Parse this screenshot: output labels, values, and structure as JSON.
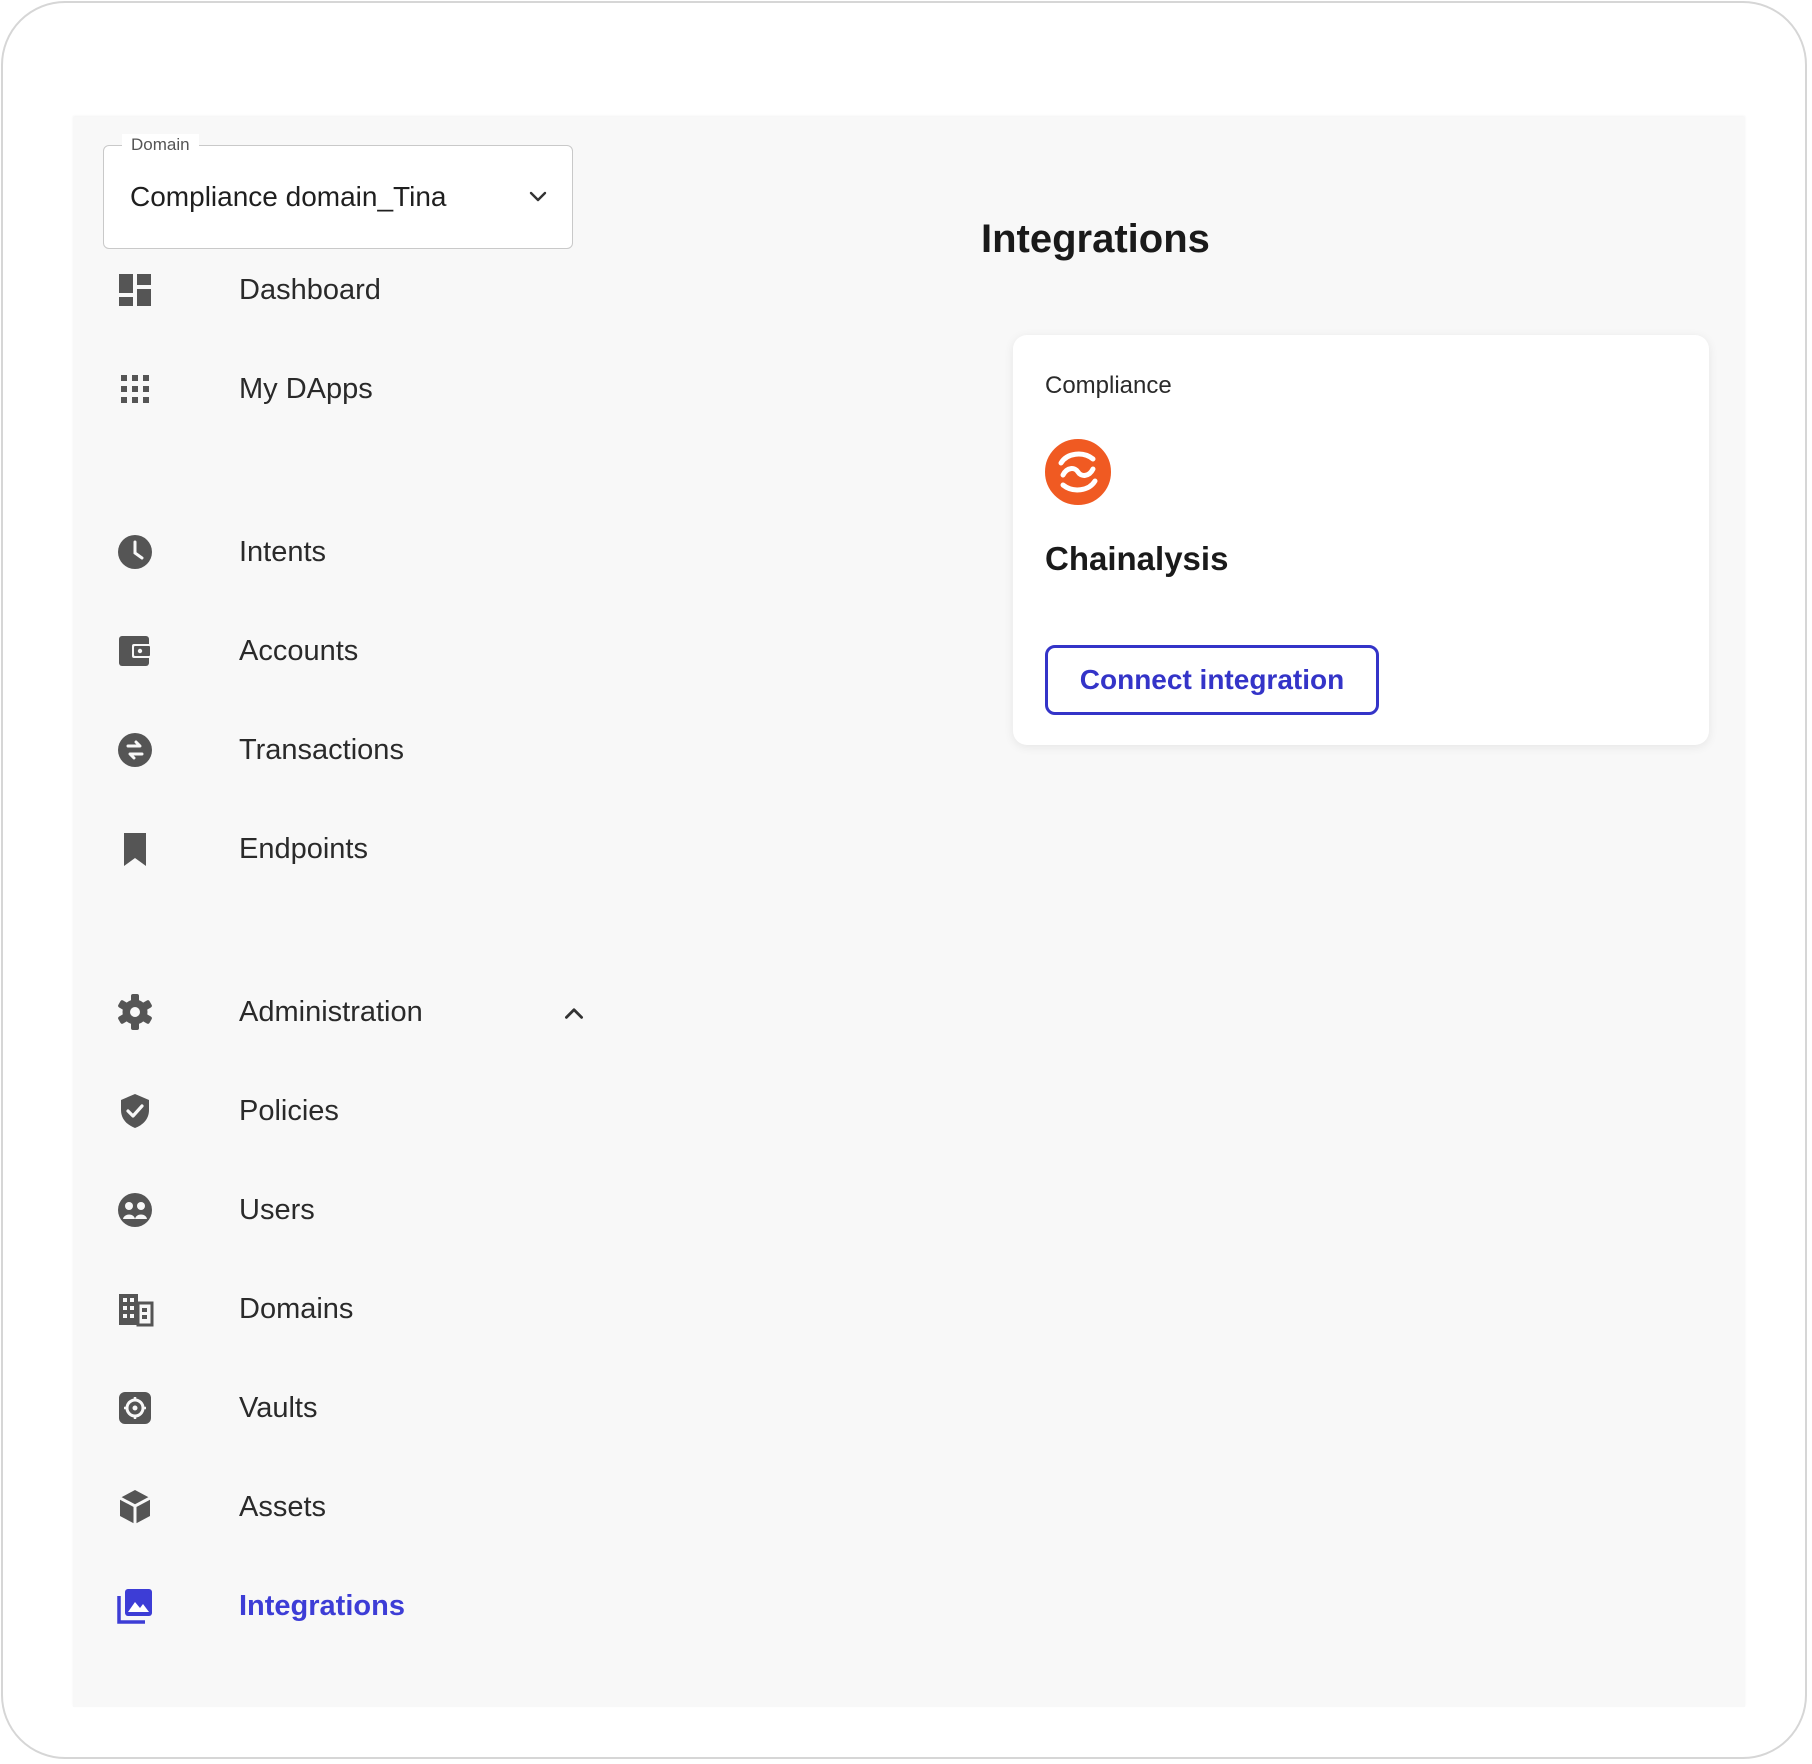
{
  "domain_select": {
    "legend": "Domain",
    "value": "Compliance domain_Tina"
  },
  "sidebar": {
    "items": [
      {
        "label": "Dashboard",
        "icon": "dashboard-icon"
      },
      {
        "label": "My DApps",
        "icon": "apps-grid-icon"
      },
      {
        "label": "Intents",
        "icon": "clock-icon"
      },
      {
        "label": "Accounts",
        "icon": "wallet-icon"
      },
      {
        "label": "Transactions",
        "icon": "swap-icon"
      },
      {
        "label": "Endpoints",
        "icon": "bookmark-icon"
      },
      {
        "label": "Administration",
        "icon": "gear-icon",
        "expanded": true
      },
      {
        "label": "Policies",
        "icon": "shield-check-icon"
      },
      {
        "label": "Users",
        "icon": "users-icon"
      },
      {
        "label": "Domains",
        "icon": "building-icon"
      },
      {
        "label": "Vaults",
        "icon": "vault-icon"
      },
      {
        "label": "Assets",
        "icon": "cube-icon"
      },
      {
        "label": "Integrations",
        "icon": "integrations-icon",
        "active": true
      }
    ]
  },
  "main": {
    "title": "Integrations",
    "card": {
      "category": "Compliance",
      "name": "Chainalysis",
      "logo": "chainalysis-logo",
      "button_label": "Connect integration"
    }
  },
  "colors": {
    "accent": "#3d3dd6",
    "icon": "#555555",
    "logo": "#f05a22",
    "background": "#f8f8f8"
  }
}
